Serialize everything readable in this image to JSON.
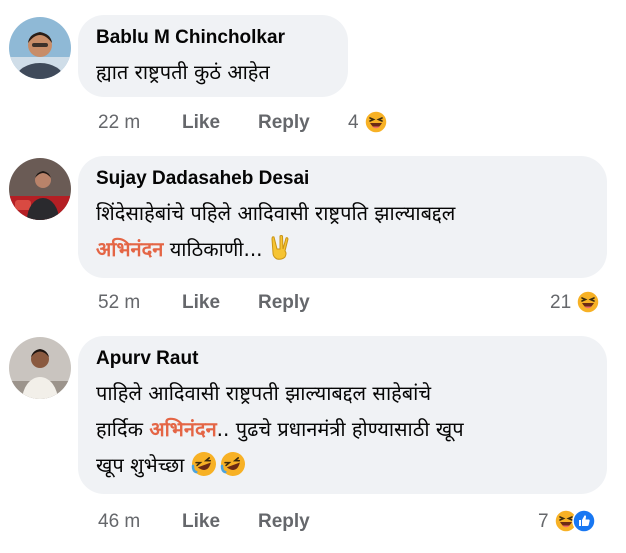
{
  "comments": [
    {
      "author": "Bablu M Chincholkar",
      "text_lines": [
        "ह्यात राष्ट्रपती कुठं आहेत"
      ],
      "time": "22 m",
      "like_label": "Like",
      "reply_label": "Reply",
      "reaction_count": "4",
      "reaction_icons": [
        "haha-reaction-icon"
      ]
    },
    {
      "author": "Sujay Dadasaheb Desai",
      "text_line1": "शिंदेसाहेबांचे पहिले आदिवासी राष्ट्रपति झाल्याबद्दल",
      "text_line2_highlight": "अभिनंदन",
      "text_line2_rest": " याठिकाणी...",
      "text_emoji": "victory-hand-emoji",
      "time": "52 m",
      "like_label": "Like",
      "reply_label": "Reply",
      "reaction_count": "21",
      "reaction_icons": [
        "haha-reaction-icon"
      ]
    },
    {
      "author": "Apurv Raut",
      "text_line1": "पाहिले आदिवासी राष्ट्रपती झाल्याबद्दल साहेबांचे",
      "text_line2_pre": "हार्दिक ",
      "text_line2_highlight": "अभिनंदन",
      "text_line2_rest": ".. पुढचे प्रधानमंत्री होण्यासाठी खूप",
      "text_line3": "खूप शुभेच्छा",
      "text_emoji": "rolling-laughing-emoji",
      "time": "46 m",
      "like_label": "Like",
      "reply_label": "Reply",
      "reaction_count": "7",
      "reaction_icons": [
        "haha-reaction-icon",
        "like-reaction-icon"
      ]
    }
  ],
  "colors": {
    "bubble": "#f0f2f5",
    "author": "#050505",
    "meta": "#65676b",
    "highlight": "#e46545",
    "haha": "#f7b125",
    "like": "#1877f2"
  }
}
